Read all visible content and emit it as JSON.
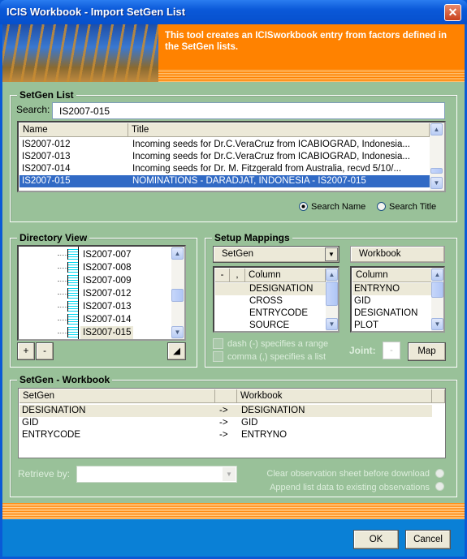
{
  "window": {
    "title": "ICIS Workbook - Import SetGen List",
    "close_icon": "close-icon"
  },
  "banner": {
    "text": "This tool creates an ICISworkbook entry from factors defined in the SetGen lists."
  },
  "setgen_list": {
    "legend": "SetGen List",
    "search_label": "Search:",
    "search_value": "IS2007-015",
    "columns": [
      "Name",
      "Title"
    ],
    "rows": [
      {
        "name": "IS2007-012",
        "title": "Incoming seeds for Dr.C.VeraCruz from ICABIOGRAD, Indonesia..."
      },
      {
        "name": "IS2007-013",
        "title": "Incoming seeds for Dr.C.VeraCruz from ICABIOGRAD, Indonesia..."
      },
      {
        "name": "IS2007-014",
        "title": "Incoming seeds for Dr. M. Fitzgerald from Australia, recvd 5/10/..."
      },
      {
        "name": "IS2007-015",
        "title": "NOMINATIONS - DARADJAT, INDONESIA - IS2007-015",
        "selected": true
      }
    ],
    "radio_search_name": "Search Name",
    "radio_search_title": "Search Title",
    "selected_radio": "Search Name"
  },
  "directory": {
    "legend": "Directory View",
    "items": [
      "IS2007-007",
      "IS2007-008",
      "IS2007-009",
      "IS2007-012",
      "IS2007-013",
      "IS2007-014",
      "IS2007-015"
    ],
    "selected": "IS2007-015",
    "expand_label": "+",
    "collapse_label": "-"
  },
  "mappings": {
    "legend": "Setup Mappings",
    "setgen_dropdown": "SetGen",
    "workbook_label": "Workbook",
    "left_headers": [
      "-",
      ",",
      "Column"
    ],
    "left_items": [
      "DESIGNATION",
      "CROSS",
      "ENTRYCODE",
      "SOURCE"
    ],
    "right_header": "Column",
    "right_items": [
      "ENTRYNO",
      "GID",
      "DESIGNATION",
      "PLOT"
    ],
    "dash_checkbox": "dash (-) specifies a range",
    "comma_checkbox": "comma (,) specifies a list",
    "joint_label": "Joint:",
    "joint_value": "-",
    "map_button": "Map"
  },
  "setgen_workbook": {
    "legend": "SetGen - Workbook",
    "columns": [
      "SetGen",
      "",
      "Workbook"
    ],
    "rows": [
      {
        "setgen": "DESIGNATION",
        "arrow": "->",
        "workbook": "DESIGNATION"
      },
      {
        "setgen": "GID",
        "arrow": "->",
        "workbook": "GID"
      },
      {
        "setgen": "ENTRYCODE",
        "arrow": "->",
        "workbook": "ENTRYNO"
      }
    ],
    "retrieve_label": "Retrieve by:",
    "retrieve_value": "",
    "clear_option": "Clear observation sheet before download",
    "append_option": "Append list data to existing observations"
  },
  "footer": {
    "ok": "OK",
    "cancel": "Cancel"
  },
  "colors": {
    "background": "#99c199",
    "accent": "#ff8200",
    "selection": "#316ac5",
    "titlebar": "#0a58d8"
  }
}
